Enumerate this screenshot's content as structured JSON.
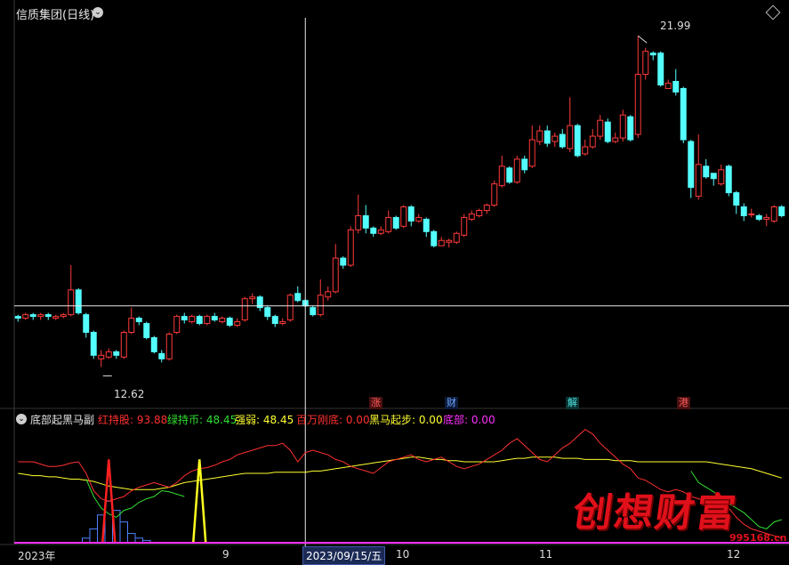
{
  "header": {
    "title": "信质集团(日线)"
  },
  "main_panel": {
    "high_label": "21.99",
    "low_label": "12.62",
    "event_markers": [
      {
        "text": "涨",
        "color": "#ff5a5a"
      },
      {
        "text": "财",
        "color": "#6fa8ff"
      },
      {
        "text": "解",
        "color": "#4fe0e0"
      },
      {
        "text": "港",
        "color": "#ff5a5a"
      }
    ]
  },
  "sub_panel": {
    "indicator_name": "底部起黑马副",
    "legend": [
      {
        "label": "红持股: 93.88",
        "color": "#ff3030"
      },
      {
        "label": "绿持币: 48.45",
        "color": "#30e030"
      },
      {
        "label": "强弱: 48.45",
        "color": "#ffff30"
      },
      {
        "label": "百万刚底: 0.00",
        "color": "#ff3030"
      },
      {
        "label": "黑马起步: 0.00",
        "color": "#ffff30"
      },
      {
        "label": "底部: 0.00",
        "color": "#ff30ff"
      }
    ]
  },
  "x_axis": {
    "labels": [
      "2023年",
      "9",
      "10",
      "11",
      "12"
    ],
    "cursor_date": "2023/09/15/五"
  },
  "watermark": {
    "logo_text": "创想财富",
    "url": "995168.cn"
  },
  "chart_data": {
    "type": "candlestick",
    "y_range": [
      11.8,
      22.5
    ],
    "price_annotations": {
      "high": 21.99,
      "low": 12.62
    },
    "candles": [
      [
        14.05,
        14.0,
        14.1,
        13.9
      ],
      [
        14.0,
        14.1,
        14.15,
        13.95
      ],
      [
        14.1,
        14.05,
        14.15,
        13.95
      ],
      [
        14.05,
        14.1,
        14.15,
        13.95
      ],
      [
        14.1,
        14.05,
        14.15,
        13.95
      ],
      [
        14.0,
        14.05,
        14.1,
        13.95
      ],
      [
        14.05,
        14.1,
        14.15,
        14.0
      ],
      [
        14.1,
        14.8,
        15.5,
        14.05
      ],
      [
        14.8,
        14.15,
        14.85,
        14.1
      ],
      [
        14.1,
        13.6,
        14.15,
        13.45
      ],
      [
        13.6,
        12.95,
        13.65,
        12.85
      ],
      [
        12.85,
        12.95,
        13.1,
        12.62
      ],
      [
        12.9,
        13.05,
        13.15,
        12.85
      ],
      [
        13.05,
        12.95,
        13.1,
        12.85
      ],
      [
        12.9,
        13.6,
        13.65,
        12.85
      ],
      [
        13.6,
        14.0,
        14.3,
        13.55
      ],
      [
        14.0,
        13.9,
        14.05,
        13.8
      ],
      [
        13.85,
        13.45,
        13.9,
        13.4
      ],
      [
        13.45,
        13.05,
        13.5,
        13.0
      ],
      [
        13.0,
        12.85,
        13.1,
        12.75
      ],
      [
        12.85,
        13.55,
        13.6,
        12.8
      ],
      [
        13.6,
        14.05,
        14.1,
        13.55
      ],
      [
        14.05,
        13.95,
        14.15,
        13.85
      ],
      [
        13.9,
        14.05,
        14.1,
        13.85
      ],
      [
        14.05,
        13.85,
        14.1,
        13.8
      ],
      [
        13.85,
        14.05,
        14.1,
        13.8
      ],
      [
        14.05,
        13.95,
        14.15,
        13.9
      ],
      [
        13.9,
        14.0,
        14.05,
        13.85
      ],
      [
        14.0,
        13.8,
        14.05,
        13.75
      ],
      [
        13.8,
        13.9,
        14.0,
        13.75
      ],
      [
        13.95,
        14.55,
        14.6,
        13.9
      ],
      [
        14.55,
        14.6,
        14.7,
        14.4
      ],
      [
        14.6,
        14.3,
        14.65,
        14.2
      ],
      [
        14.3,
        14.05,
        14.35,
        13.95
      ],
      [
        14.05,
        13.85,
        14.1,
        13.75
      ],
      [
        13.85,
        13.9,
        14.0,
        13.8
      ],
      [
        13.95,
        14.65,
        14.7,
        13.9
      ],
      [
        14.7,
        14.5,
        14.9,
        14.45
      ],
      [
        14.5,
        14.35,
        14.55,
        14.3
      ],
      [
        14.3,
        14.1,
        14.35,
        14.05
      ],
      [
        14.1,
        14.65,
        15.1,
        14.05
      ],
      [
        14.6,
        14.75,
        14.9,
        14.5
      ],
      [
        14.75,
        15.7,
        16.1,
        14.7
      ],
      [
        15.7,
        15.5,
        15.75,
        15.4
      ],
      [
        15.5,
        16.5,
        16.6,
        15.45
      ],
      [
        16.5,
        16.9,
        17.5,
        16.4
      ],
      [
        16.9,
        16.55,
        17.2,
        16.4
      ],
      [
        16.55,
        16.4,
        16.6,
        16.3
      ],
      [
        16.4,
        16.5,
        16.6,
        16.35
      ],
      [
        16.45,
        16.85,
        17.05,
        16.4
      ],
      [
        16.85,
        16.55,
        16.9,
        16.5
      ],
      [
        16.6,
        17.15,
        17.2,
        16.55
      ],
      [
        17.15,
        16.75,
        17.2,
        16.6
      ],
      [
        16.75,
        16.85,
        16.95,
        16.7
      ],
      [
        16.8,
        16.45,
        16.85,
        16.3
      ],
      [
        16.45,
        16.05,
        16.5,
        16.0
      ],
      [
        16.05,
        16.2,
        16.3,
        16.05
      ],
      [
        16.15,
        16.2,
        16.25,
        16.0
      ],
      [
        16.15,
        16.4,
        16.45,
        16.1
      ],
      [
        16.35,
        16.85,
        16.95,
        16.3
      ],
      [
        16.8,
        16.95,
        17.05,
        16.75
      ],
      [
        16.9,
        17.05,
        17.1,
        16.85
      ],
      [
        17.05,
        17.2,
        17.25,
        16.95
      ],
      [
        17.2,
        17.8,
        17.9,
        17.15
      ],
      [
        17.75,
        18.3,
        18.6,
        17.7
      ],
      [
        18.25,
        17.85,
        18.3,
        17.8
      ],
      [
        17.85,
        18.5,
        18.6,
        17.8
      ],
      [
        18.5,
        18.2,
        18.6,
        18.1
      ],
      [
        18.3,
        19.05,
        19.45,
        18.25
      ],
      [
        19.0,
        19.3,
        19.45,
        18.9
      ],
      [
        19.3,
        18.95,
        19.45,
        18.85
      ],
      [
        19.0,
        19.15,
        19.25,
        18.85
      ],
      [
        19.2,
        18.85,
        19.35,
        18.8
      ],
      [
        18.8,
        19.45,
        20.25,
        18.7
      ],
      [
        19.45,
        18.6,
        19.5,
        18.55
      ],
      [
        18.65,
        18.85,
        19.05,
        18.6
      ],
      [
        18.85,
        19.15,
        19.35,
        18.8
      ],
      [
        19.15,
        19.6,
        19.75,
        19.05
      ],
      [
        19.55,
        19.0,
        19.65,
        18.95
      ],
      [
        19.0,
        19.1,
        19.25,
        18.95
      ],
      [
        19.1,
        19.75,
        19.9,
        19.0
      ],
      [
        19.7,
        19.05,
        19.75,
        19.0
      ],
      [
        19.2,
        20.9,
        21.99,
        19.1
      ],
      [
        20.9,
        21.55,
        21.65,
        20.75
      ],
      [
        21.5,
        21.45,
        21.55,
        21.3
      ],
      [
        21.5,
        20.6,
        21.55,
        20.55
      ],
      [
        20.5,
        20.65,
        20.75,
        20.5
      ],
      [
        20.7,
        20.4,
        21.05,
        20.3
      ],
      [
        20.5,
        19.05,
        20.55,
        18.95
      ],
      [
        19.0,
        17.7,
        19.05,
        17.4
      ],
      [
        17.45,
        18.35,
        19.2,
        17.35
      ],
      [
        18.3,
        18.0,
        18.5,
        17.95
      ],
      [
        18.1,
        17.95,
        18.1,
        17.75
      ],
      [
        17.8,
        18.2,
        18.35,
        17.75
      ],
      [
        18.3,
        17.55,
        18.35,
        17.45
      ],
      [
        17.55,
        17.2,
        17.6,
        16.95
      ],
      [
        17.15,
        16.9,
        17.25,
        16.75
      ],
      [
        16.95,
        16.95,
        17.1,
        16.85
      ],
      [
        16.9,
        16.8,
        16.95,
        16.75
      ],
      [
        16.8,
        16.85,
        16.95,
        16.6
      ],
      [
        16.75,
        17.15,
        17.2,
        16.7
      ],
      [
        17.15,
        16.9,
        17.2,
        16.85
      ]
    ],
    "cursor_index": 38,
    "indicator_series": {
      "红持股": [
        70,
        70,
        70,
        68,
        66,
        66,
        67,
        69,
        70,
        60,
        45,
        38,
        36,
        38,
        40,
        45,
        48,
        50,
        52,
        50,
        48,
        52,
        58,
        62,
        64,
        65,
        67,
        70,
        72,
        76,
        78,
        80,
        82,
        84,
        84,
        86,
        80,
        70,
        78,
        80,
        78,
        76,
        72,
        70,
        66,
        64,
        62,
        60,
        65,
        70,
        72,
        74,
        76,
        72,
        70,
        72,
        74,
        70,
        66,
        64,
        66,
        68,
        72,
        76,
        80,
        86,
        90,
        84,
        78,
        72,
        70,
        76,
        82,
        86,
        92,
        98,
        94,
        86,
        80,
        74,
        68,
        64,
        56,
        54,
        50,
        46,
        44,
        46,
        44,
        40,
        38,
        36,
        34,
        32,
        30,
        22,
        16,
        12,
        10,
        8,
        6,
        4
      ],
      "绿持币": [
        null,
        null,
        null,
        null,
        null,
        null,
        null,
        null,
        null,
        55,
        40,
        30,
        25,
        22,
        28,
        30,
        35,
        38,
        40,
        45,
        44,
        42,
        40,
        null,
        null,
        null,
        null,
        null,
        null,
        null,
        null,
        null,
        null,
        null,
        null,
        null,
        null,
        null,
        null,
        null,
        null,
        null,
        null,
        null,
        null,
        null,
        null,
        null,
        null,
        null,
        null,
        null,
        null,
        null,
        null,
        null,
        null,
        null,
        null,
        null,
        null,
        null,
        null,
        null,
        null,
        null,
        null,
        null,
        null,
        null,
        null,
        null,
        null,
        null,
        null,
        null,
        null,
        null,
        null,
        null,
        null,
        null,
        null,
        null,
        null,
        null,
        null,
        null,
        null,
        62,
        52,
        48,
        44,
        40,
        34,
        30,
        26,
        20,
        14,
        12,
        18,
        20
      ],
      "强弱": [
        60,
        59,
        58,
        58,
        57,
        57,
        56,
        55,
        55,
        54,
        53,
        51,
        49,
        48,
        47,
        46,
        46,
        46,
        46,
        47,
        48,
        50,
        52,
        53,
        54,
        55,
        56,
        57,
        58,
        59,
        60,
        60,
        60,
        60,
        61,
        61,
        61,
        61,
        61,
        62,
        62,
        63,
        64,
        65,
        66,
        67,
        68,
        69,
        70,
        71,
        72,
        73,
        74,
        74,
        73,
        72,
        72,
        71,
        71,
        70,
        70,
        70,
        70,
        70,
        71,
        72,
        73,
        73,
        74,
        74,
        74,
        74,
        73,
        73,
        73,
        72,
        72,
        72,
        72,
        71,
        71,
        71,
        70,
        70,
        70,
        70,
        70,
        70,
        70,
        70,
        70,
        70,
        69,
        68,
        67,
        66,
        65,
        64,
        62,
        60,
        58,
        56
      ],
      "底部": [
        0,
        0,
        0,
        0,
        0,
        0,
        0,
        0,
        0,
        2,
        6,
        12,
        18,
        14,
        9,
        4,
        2,
        1,
        0,
        0,
        0,
        0,
        0,
        0,
        0,
        0,
        0,
        0,
        0,
        0,
        0,
        0,
        0,
        0,
        0,
        0,
        0,
        0,
        0,
        0,
        0,
        0,
        0,
        0,
        0,
        0,
        0,
        0,
        0,
        0,
        0,
        0,
        0,
        0,
        0,
        0,
        0,
        0,
        0,
        0,
        0,
        0,
        0,
        0,
        0,
        0,
        0,
        0,
        0,
        0,
        0,
        0,
        0,
        0,
        0,
        0,
        0,
        0,
        0,
        0,
        0,
        0,
        0,
        0,
        0,
        0,
        0,
        0,
        0,
        0,
        0,
        0,
        0,
        0,
        0,
        0,
        0,
        0,
        0,
        0,
        0,
        0
      ],
      "百万刚底_spike_index": 12,
      "黑马起步_spike_index": 24
    }
  }
}
